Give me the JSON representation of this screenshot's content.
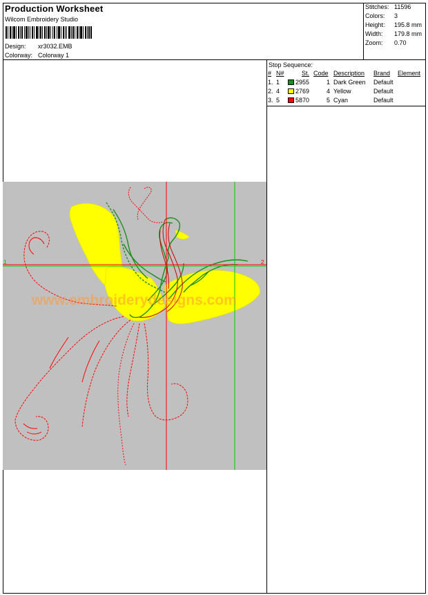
{
  "header": {
    "title": "Production Worksheet",
    "software": "Wilcom Embroidery Studio",
    "design_label": "Design:",
    "design_value": "xr3032.EMB",
    "colorway_label": "Colorway:",
    "colorway_value": "Colorway 1"
  },
  "stats": {
    "stitches_label": "Stitches:",
    "stitches_value": "11596",
    "colors_label": "Colors:",
    "colors_value": "3",
    "height_label": "Height:",
    "height_value": "195.8 mm",
    "width_label": "Width:",
    "width_value": "179.8 mm",
    "zoom_label": "Zoom:",
    "zoom_value": "0.70"
  },
  "stop_sequence": {
    "title": "Stop Sequence:",
    "headers": {
      "num": "#",
      "needle": "N#",
      "st": "St.",
      "code": "Code",
      "description": "Description",
      "brand": "Brand",
      "element": "Element"
    },
    "rows": [
      {
        "num": "1.",
        "needle": "1",
        "color": "#1a8f1a",
        "code_num": "2955",
        "code": "1",
        "description": "Dark Green",
        "brand": "Default"
      },
      {
        "num": "2.",
        "needle": "4",
        "color": "#ffff00",
        "code_num": "2769",
        "code": "4",
        "description": "Yellow",
        "brand": "Default"
      },
      {
        "num": "3.",
        "needle": "5",
        "color": "#ff0000",
        "code_num": "5870",
        "code": "5",
        "description": "Cyan",
        "brand": "Default"
      }
    ]
  },
  "preview": {
    "watermark": "www.embroiderydesigns.com",
    "marker_1": "1",
    "marker_2": "2",
    "colors": {
      "background": "#c0c0c0",
      "red": "#ff0000",
      "green": "#00cc00",
      "yellow": "#ffff00",
      "dark_green": "#1a8f1a"
    }
  }
}
